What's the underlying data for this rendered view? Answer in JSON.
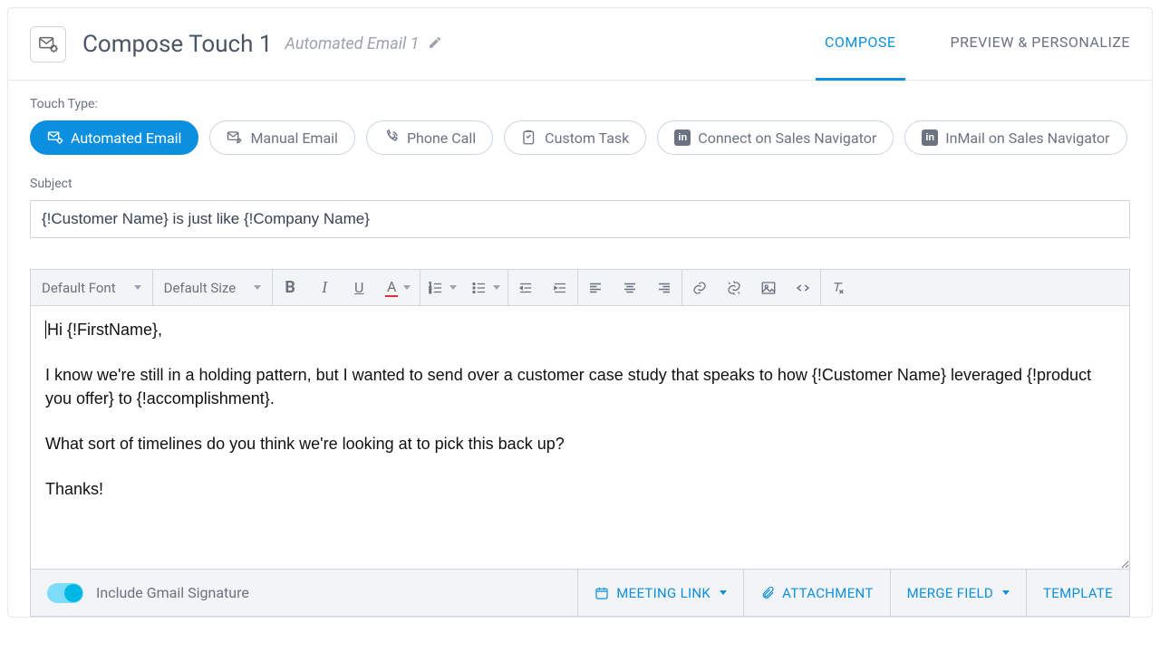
{
  "header": {
    "title": "Compose Touch 1",
    "subtitle": "Automated Email 1"
  },
  "tabs": {
    "compose": "COMPOSE",
    "preview": "PREVIEW & PERSONALIZE"
  },
  "touchType": {
    "label": "Touch Type:",
    "options": {
      "automated_email": "Automated Email",
      "manual_email": "Manual Email",
      "phone_call": "Phone Call",
      "custom_task": "Custom Task",
      "connect_navigator": "Connect on Sales Navigator",
      "inmail_navigator": "InMail on Sales Navigator"
    }
  },
  "subject": {
    "label": "Subject",
    "value": "{!Customer Name} is just like {!Company Name}"
  },
  "toolbar": {
    "font": "Default Font",
    "size": "Default Size"
  },
  "body_lines": {
    "l1": "Hi {!FirstName},",
    "l2": "",
    "l3": "I know we're still in a holding pattern, but I wanted to send over a customer case study that speaks to how {!Customer Name} leveraged {!product you offer} to {!accomplishment}.",
    "l4": "",
    "l5": "What sort of timelines do you think we're looking at to pick this back up?",
    "l6": "",
    "l7": "Thanks!"
  },
  "footer": {
    "signature_label": "Include Gmail Signature",
    "meeting_link": "MEETING LINK",
    "attachment": "ATTACHMENT",
    "merge_field": "MERGE FIELD",
    "template": "TEMPLATE"
  }
}
